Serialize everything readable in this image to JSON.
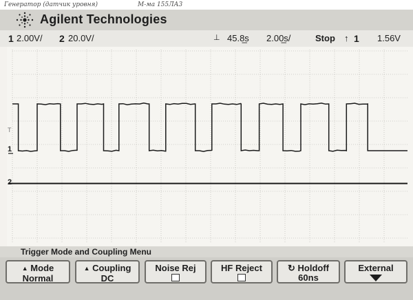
{
  "note": {
    "left": "Генератор (датчик уровня)",
    "right": "М-ма  155ЛА3"
  },
  "brand": {
    "name": "Agilent Technologies",
    "logo_icon": "agilent-spark-icon"
  },
  "status": {
    "ch1_num": "1",
    "ch1_scale": "2.00V/",
    "ch2_num": "2",
    "ch2_scale": "20.0V/",
    "delay_marker": "⊥",
    "delay": "45.8̲s",
    "timebase": "2.00̲s/",
    "run_state": "Stop",
    "trigger_edge": "↑",
    "trigger_source": "1",
    "trigger_level": "1.56V"
  },
  "screen": {
    "ch1_marker": "1",
    "ch2_marker": "2",
    "trig_marker": "T",
    "colors": {
      "grid": "#c4c3bd",
      "trace": "#1a1a1a",
      "background": "#f6f5f1"
    },
    "waveform": {
      "type": "square",
      "levels_divs": {
        "high": 2.0,
        "low": 0.0
      },
      "transitions_divs": [
        0.24,
        1.0,
        1.94,
        2.61,
        3.68,
        4.3,
        5.52,
        6.19,
        7.38,
        8.05,
        9.23,
        9.96,
        10.92,
        11.64,
        12.77,
        13.48,
        14.34
      ]
    },
    "ch2_level_divs": -1.4
  },
  "menu": {
    "title": "Trigger Mode and Coupling Menu"
  },
  "softkeys": [
    {
      "label": "Mode",
      "value": "Normal",
      "icon": "triangle-up-icon"
    },
    {
      "label": "Coupling",
      "value": "DC",
      "icon": "triangle-up-icon"
    },
    {
      "label": "Noise Rej",
      "value": "",
      "icon": "checkbox-icon",
      "checked": false
    },
    {
      "label": "HF Reject",
      "value": "",
      "icon": "checkbox-icon",
      "checked": false
    },
    {
      "label": "Holdoff",
      "value": "60ns",
      "icon": "rotary-knob-icon"
    },
    {
      "label": "External",
      "value": "",
      "icon": "arrow-down-icon"
    }
  ]
}
